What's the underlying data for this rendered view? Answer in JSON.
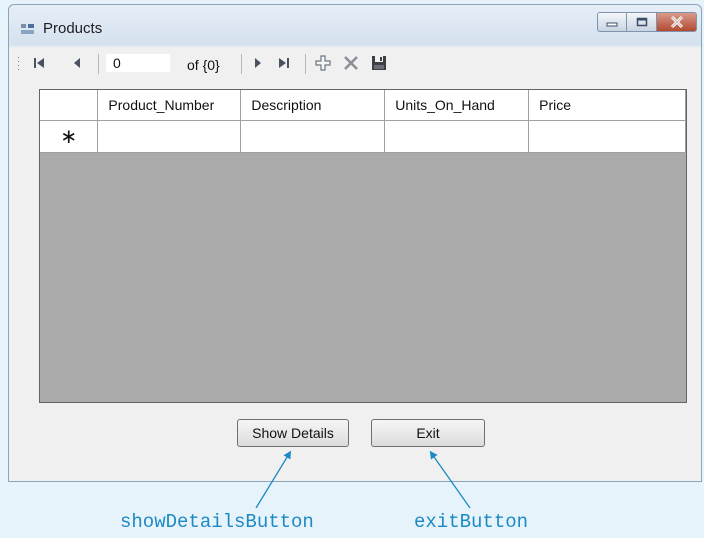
{
  "window": {
    "title": "Products"
  },
  "navigator": {
    "position_value": "0",
    "count_text": "of {0}"
  },
  "grid": {
    "columns": [
      "Product_Number",
      "Description",
      "Units_On_Hand",
      "Price"
    ],
    "new_row_marker": "∗"
  },
  "buttons": {
    "show_details": "Show Details",
    "exit": "Exit"
  },
  "annotations": {
    "show_details_name": "showDetailsButton",
    "exit_name": "exitButton"
  },
  "colors": {
    "annotation": "#1d8ac4",
    "grid_background": "#ababab",
    "window_frame": "#dde7f2"
  }
}
